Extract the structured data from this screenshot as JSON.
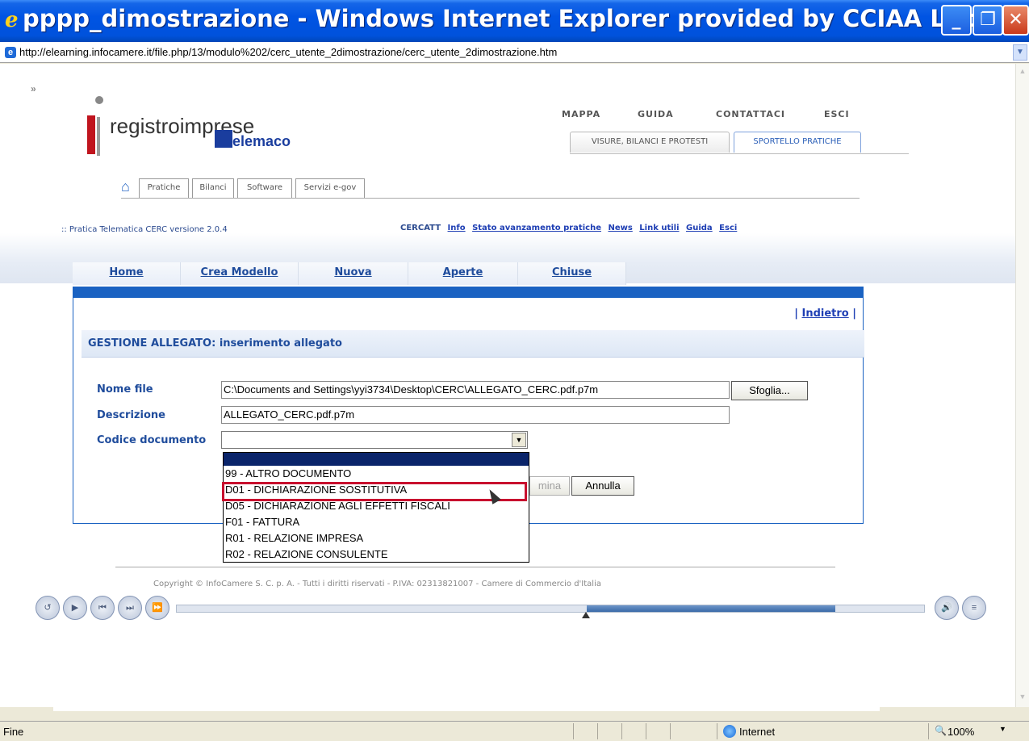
{
  "window": {
    "title": "pppp_dimostrazione - Windows Internet Explorer provided by CCIAA Lecce",
    "url": "http://elearning.infocamere.it/file.php/13/modulo%202/cerc_utente_2dimostrazione/cerc_utente_2dimostrazione.htm"
  },
  "site": {
    "logo_text": "registroimprese",
    "telemaco_text": "elemaco",
    "top_nav": [
      "MAPPA",
      "GUIDA",
      "CONTATTACI",
      "ESCI"
    ],
    "top_tabs": [
      "VISURE, BILANCI E PROTESTI",
      "SPORTELLO PRATICHE"
    ],
    "section_tabs": [
      "Pratiche",
      "Bilanci",
      "Software",
      "Servizi e-gov"
    ]
  },
  "cerc": {
    "version": ":: Pratica Telematica CERC versione 2.0.4",
    "links": [
      "CERCATT",
      "Info",
      "Stato avanzamento pratiche",
      "News",
      "Link utili",
      "Guida",
      "Esci"
    ]
  },
  "menu": [
    "Home",
    "Crea Modello",
    "Nuova",
    "Aperte",
    "Chiuse"
  ],
  "form": {
    "back_link": "Indietro",
    "section_title": "GESTIONE ALLEGATO: inserimento allegato",
    "nome_file_label": "Nome file",
    "nome_file_value": "C:\\Documents and Settings\\yyi3734\\Desktop\\CERC\\ALLEGATO_CERC.pdf.p7m",
    "browse_label": "Sfoglia...",
    "descrizione_label": "Descrizione",
    "descrizione_value": "ALLEGATO_CERC.pdf.p7m",
    "codice_label": "Codice documento",
    "hidden_button_label": "mina",
    "cancel_label": "Annulla",
    "options": [
      "99 - ALTRO DOCUMENTO",
      "D01 - DICHIARAZIONE SOSTITUTIVA",
      "D05 - DICHIARAZIONE AGLI EFFETTI FISCALI",
      "F01 - FATTURA",
      "R01 - RELAZIONE IMPRESA",
      "R02 - RELAZIONE CONSULENTE"
    ],
    "highlight_color": "#c8102e"
  },
  "footer": {
    "copyright": "Copyright © InfoCamere S. C. p. A. - Tutti i diritti riservati - P.IVA: 02313821007 - Camere di Commercio d'Italia"
  },
  "player": {
    "progress_fraction": 0.55
  },
  "status": {
    "text": "Fine",
    "zone": "Internet",
    "zoom": "100%"
  }
}
